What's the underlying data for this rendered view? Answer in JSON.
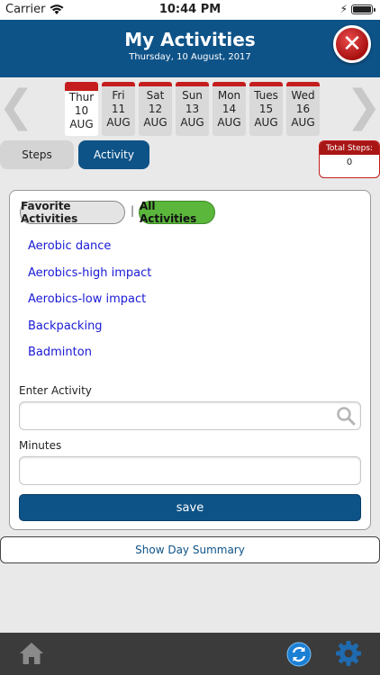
{
  "status_bar": {
    "carrier": "Carrier",
    "time": "10:44 PM"
  },
  "header": {
    "title": "My Activities",
    "date": "Thursday, 10 August, 2017"
  },
  "days": [
    {
      "dow": "Thur",
      "day": "10",
      "month": "AUG",
      "selected": true
    },
    {
      "dow": "Fri",
      "day": "11",
      "month": "AUG",
      "selected": false
    },
    {
      "dow": "Sat",
      "day": "12",
      "month": "AUG",
      "selected": false
    },
    {
      "dow": "Sun",
      "day": "13",
      "month": "AUG",
      "selected": false
    },
    {
      "dow": "Mon",
      "day": "14",
      "month": "AUG",
      "selected": false
    },
    {
      "dow": "Tues",
      "day": "15",
      "month": "AUG",
      "selected": false
    },
    {
      "dow": "Wed",
      "day": "16",
      "month": "AUG",
      "selected": false
    }
  ],
  "tabs": {
    "steps": "Steps",
    "activity": "Activity"
  },
  "total_steps": {
    "label": "Total Steps:",
    "value": "0"
  },
  "filters": {
    "favorite": "Favorite Activities",
    "separator": "|",
    "all": "All Activities"
  },
  "activities": [
    "Aerobic dance",
    "Aerobics-high impact",
    "Aerobics-low impact",
    "Backpacking",
    "Badminton"
  ],
  "form": {
    "activity_label": "Enter Activity",
    "activity_value": "",
    "minutes_label": "Minutes",
    "minutes_value": "",
    "save_label": "save"
  },
  "summary_button": "Show Day Summary",
  "colors": {
    "brand": "#0e5388",
    "accent_red": "#c51d1d",
    "active_filter": "#5bb63c",
    "link": "#1a1ad6"
  },
  "icons": [
    "wifi-icon",
    "battery-icon",
    "close-icon",
    "chevron-left-icon",
    "chevron-right-icon",
    "search-icon",
    "home-icon",
    "refresh-icon",
    "gear-icon"
  ]
}
